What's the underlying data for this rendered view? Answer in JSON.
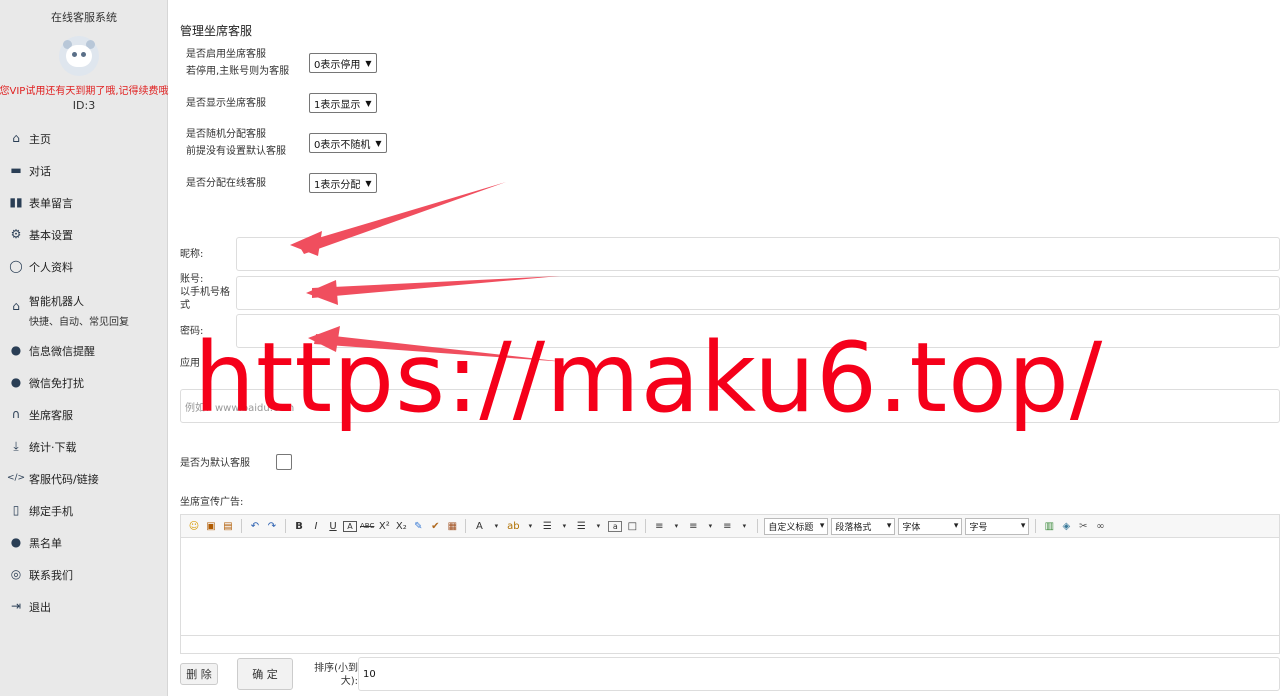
{
  "sidebar": {
    "title": "在线客服系统",
    "warning": "您VIP试用还有天到期了哦,记得续费哦",
    "id_label": "ID:3",
    "items": [
      {
        "label": "主页",
        "icon": "home-icon",
        "glyph": "⌂"
      },
      {
        "label": "对话",
        "icon": "chat-icon",
        "glyph": "▬"
      },
      {
        "label": "表单留言",
        "icon": "book-icon",
        "glyph": "▮▮"
      },
      {
        "label": "基本设置",
        "icon": "gear-icon",
        "glyph": "⚙"
      },
      {
        "label": "个人资料",
        "icon": "user-circle-icon",
        "glyph": "◯"
      },
      {
        "label": "智能机器人",
        "sub": "快捷、自动、常见回复",
        "icon": "robot-icon",
        "glyph": "⌂"
      },
      {
        "label": "信息微信提醒",
        "icon": "wechat-icon",
        "glyph": "●"
      },
      {
        "label": "微信免打扰",
        "icon": "wechat-icon",
        "glyph": "●"
      },
      {
        "label": "坐席客服",
        "icon": "headset-icon",
        "glyph": "∩"
      },
      {
        "label": "统计·下载",
        "icon": "download-icon",
        "glyph": "⤓"
      },
      {
        "label": "客服代码/链接",
        "icon": "code-icon",
        "glyph": "</>"
      },
      {
        "label": "绑定手机",
        "icon": "phone-icon",
        "glyph": "▯"
      },
      {
        "label": "黑名单",
        "icon": "blacklist-icon",
        "glyph": "●"
      },
      {
        "label": "联系我们",
        "icon": "support-icon",
        "glyph": "◎"
      },
      {
        "label": "退出",
        "icon": "logout-icon",
        "glyph": "⇥"
      }
    ]
  },
  "main": {
    "heading": "管理坐席客服",
    "options": [
      {
        "label_line1": "是否启用坐席客服",
        "label_line2": "若停用,主账号则为客服",
        "value": "0表示停用"
      },
      {
        "label_line1": "是否显示坐席客服",
        "label_line2": "",
        "value": "1表示显示"
      },
      {
        "label_line1": "是否随机分配客服",
        "label_line2": "前提没有设置默认客服",
        "value": "0表示不随机"
      },
      {
        "label_line1": "是否分配在线客服",
        "label_line2": "",
        "value": "1表示分配"
      }
    ],
    "fields": {
      "nickname_label": "昵称:",
      "account_label": "账号:",
      "account_hint": "以手机号格式",
      "password_label": "密码:",
      "app_label": "应用",
      "app_placeholder": "例如：www.baidu.com",
      "default_label": "是否为默认客服",
      "ad_label": "坐席宣传广告:",
      "sort_label": "排序(小到大):",
      "sort_value": "10"
    },
    "toolbar": {
      "buttons": [
        "☺",
        "▣",
        "▤",
        "↶",
        "↷",
        "B",
        "I",
        "U",
        "A",
        "ABC",
        "X²",
        "X₂",
        "✎",
        "✔",
        "▦",
        "A",
        "ab",
        "☰",
        "☰",
        "a",
        "□",
        "≡",
        "≡",
        "≡"
      ],
      "custom_heading": "自定义标题",
      "paragraph": "段落格式",
      "font": "字体",
      "size": "字号",
      "extra": [
        "▥",
        "◈",
        "✂",
        "∞"
      ]
    },
    "actions": {
      "delete": "删 除",
      "confirm": "确 定"
    }
  },
  "watermark": "https://maku6.top/",
  "colors": {
    "watermark": "#f5001a",
    "arrow": "#f04e5e",
    "warning": "#e02020"
  }
}
